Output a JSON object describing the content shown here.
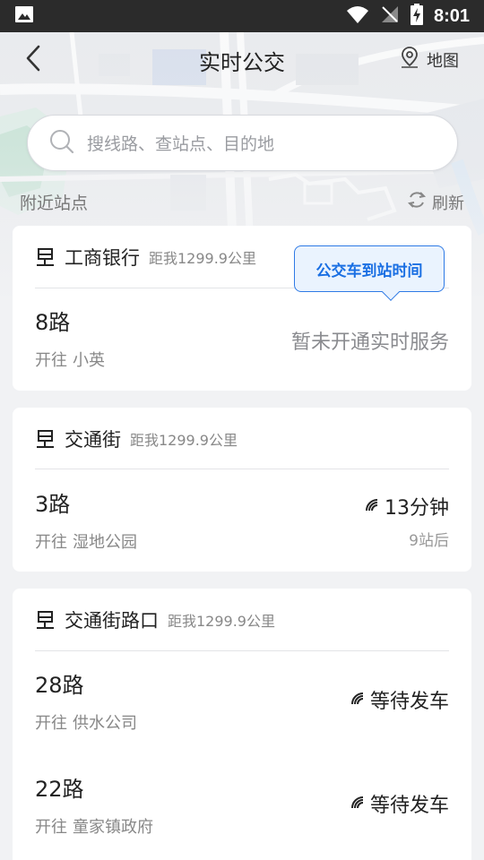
{
  "status_bar": {
    "time": "8:01",
    "icons": [
      "image-icon",
      "wifi-icon",
      "no-signal-icon",
      "battery-charging-icon"
    ]
  },
  "header": {
    "title": "实时公交",
    "back_icon": "chevron-left-icon",
    "map_label": "地图",
    "map_icon": "location-pin-icon"
  },
  "search": {
    "placeholder": "搜线路、查站点、目的地",
    "icon": "search-icon"
  },
  "nearby": {
    "label": "附近站点",
    "refresh_label": "刷新",
    "refresh_icon": "refresh-icon"
  },
  "tooltip": {
    "text": "公交车到站时间"
  },
  "stops": [
    {
      "name": "工商银行",
      "distance": "距我1299.9公里",
      "routes": [
        {
          "route": "8路",
          "direction_prefix": "开往",
          "destination": "小英",
          "status": "暂未开通实时服务",
          "sub": ""
        }
      ]
    },
    {
      "name": "交通街",
      "distance": "距我1299.9公里",
      "routes": [
        {
          "route": "3路",
          "direction_prefix": "开往",
          "destination": "湿地公园",
          "status": "13分钟",
          "sub": "9站后"
        }
      ]
    },
    {
      "name": "交通街路口",
      "distance": "距我1299.9公里",
      "routes": [
        {
          "route": "28路",
          "direction_prefix": "开往",
          "destination": "供水公司",
          "status": "等待发车",
          "sub": ""
        },
        {
          "route": "22路",
          "direction_prefix": "开往",
          "destination": "童家镇政府",
          "status": "等待发车",
          "sub": ""
        }
      ]
    }
  ],
  "colors": {
    "accent": "#1a6fe3",
    "status_bar": "#2b2b2b",
    "background": "#f1f2f4"
  }
}
